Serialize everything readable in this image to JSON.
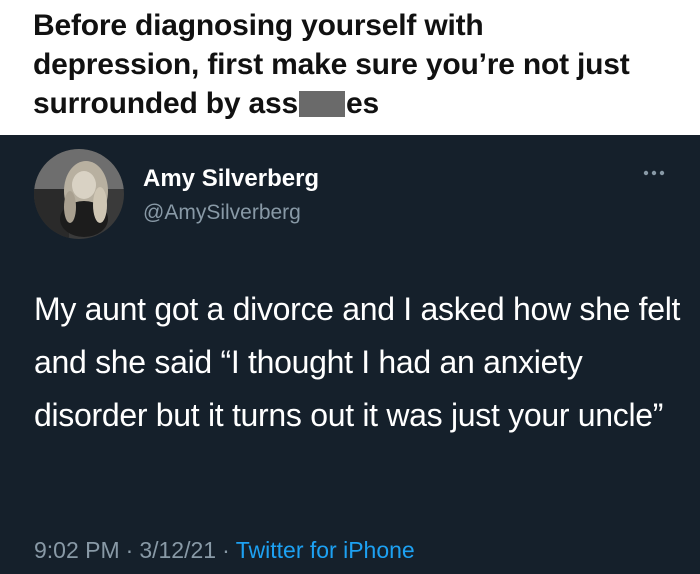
{
  "caption": {
    "line1": "Before diagnosing yourself with",
    "line2": "depression, first make sure you’re not just",
    "line3_start": "surrounded by ass",
    "line3_end": "es"
  },
  "tweet": {
    "display_name": "Amy Silverberg",
    "handle": "@AmySilverberg",
    "text": "My aunt got a divorce and I asked how she felt and she said “I thought I had an anxiety disorder but it turns out it was just your uncle”",
    "time": "9:02 PM",
    "date": "3/12/21",
    "source": "Twitter for iPhone",
    "separator": "·"
  },
  "colors": {
    "tweet_background": "#15202b",
    "secondary_text": "#8899a6",
    "link_blue": "#1da1f2",
    "censor_gray": "#6a6a6a"
  },
  "icons": {
    "more": "more-options-icon",
    "avatar": "profile-photo"
  }
}
